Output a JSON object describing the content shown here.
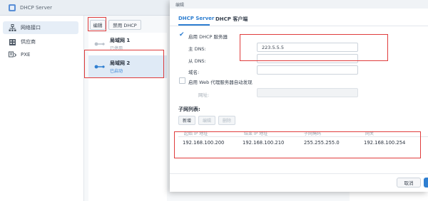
{
  "app": {
    "title": "DHCP Server",
    "icon": "dhcp-server-app-icon"
  },
  "sidebar": {
    "items": [
      {
        "label": "网络接口",
        "icon": "network-interface-icon",
        "selected": true
      },
      {
        "label": "供应商",
        "icon": "vendor-icon",
        "selected": false
      },
      {
        "label": "PXE",
        "icon": "pxe-icon",
        "selected": false
      }
    ]
  },
  "toolbar": {
    "edit_label": "编辑",
    "disable_label": "禁用 DHCP"
  },
  "interfaces": [
    {
      "name": "局域网 1",
      "status": "已停用",
      "active": false
    },
    {
      "name": "局域网 2",
      "status": "已启动",
      "active": true
    }
  ],
  "dialog": {
    "title": "编辑",
    "tabs": [
      {
        "label": "DHCP Server",
        "active": true
      },
      {
        "label": "DHCP 客户端",
        "active": false
      }
    ],
    "enable_dhcp_label": "启用 DHCP 服务器",
    "enable_dhcp_checked": true,
    "primary_dns_label": "主 DNS:",
    "primary_dns_value": "223.5.5.5",
    "secondary_dns_label": "从 DNS:",
    "secondary_dns_value": "",
    "domain_label": "域名:",
    "domain_value": "",
    "web_proxy_label": "启用 Web 代理服务器自动发现",
    "web_proxy_checked": false,
    "url_label": "网址:",
    "url_value": "",
    "subnet_list_title": "子网列表:",
    "subnet_buttons": {
      "add": "新增",
      "edit": "编辑",
      "delete": "删除"
    },
    "subnet_table": {
      "columns": [
        "起始 IP 地址",
        "结束 IP 地址",
        "子网掩码",
        "网关"
      ],
      "rows": [
        [
          "192.168.100.200",
          "192.168.100.210",
          "255.255.255.0",
          "192.168.100.254"
        ]
      ]
    },
    "cancel_label": "取消"
  },
  "colors": {
    "accent": "#2f7fd1",
    "highlight_box": "#e03c3c",
    "selected_bg": "#dfeaf6"
  }
}
